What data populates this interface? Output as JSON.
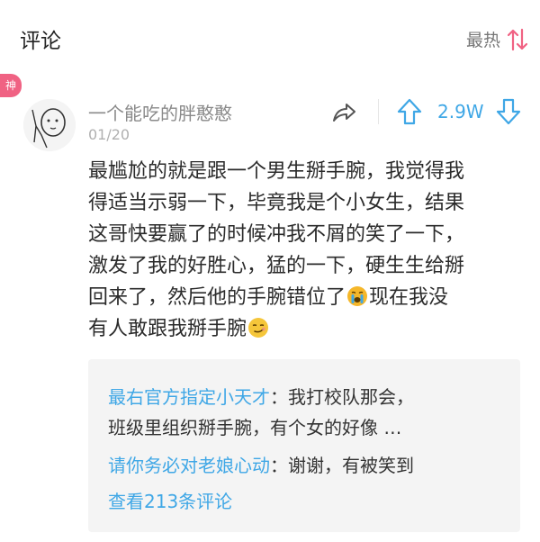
{
  "header": {
    "title": "评论",
    "sort_label": "最热",
    "sort_icon": "sort-arrows-icon",
    "accent_color": "#f06283"
  },
  "comment": {
    "badge": "神",
    "username": "一个能吃的胖憨憨",
    "date": "01/20",
    "vote_count": "2.9W",
    "text_lines": [
      "最尴尬的就是跟一个男生掰手腕，我觉得我",
      "得适当示弱一下，毕竟我是个小女生，结果",
      "这哥快要赢了的时候冲我不屑的笑了一下，",
      "激发了我的好胜心，猛的一下，硬生生给掰",
      "回来了，然后他的手腕错位了",
      "现在我没",
      "有人敢跟我掰手腕"
    ],
    "emojis": [
      "crying-emoji",
      "smirk-emoji"
    ]
  },
  "replies": {
    "items": [
      {
        "name": "最右官方指定小天才",
        "sep": "：",
        "text": "我打校队那会，"
      },
      {
        "continuation": "班级里组织掰手腕，有个女的好像 …"
      },
      {
        "name": "请你务必对老娘心动",
        "sep": "：",
        "text": "谢谢，有被笑到"
      }
    ],
    "view_more": "查看213条评论"
  },
  "colors": {
    "link_blue": "#3fa7e6",
    "badge_pink": "#f06283",
    "reply_bg": "#f4f4f4"
  }
}
